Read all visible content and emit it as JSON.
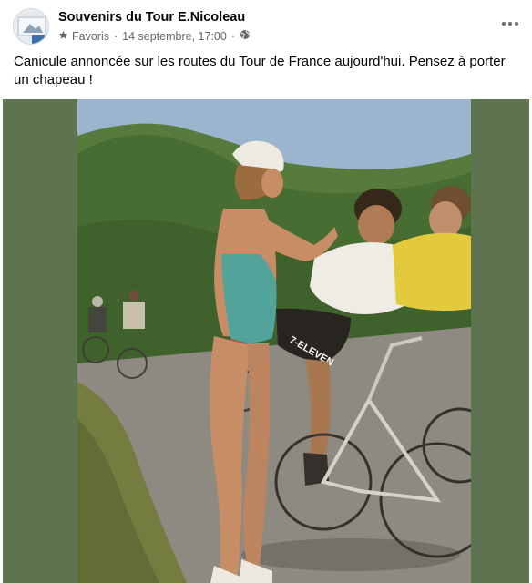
{
  "post": {
    "author": "Souvenirs du Tour E.Nicoleau",
    "audience": "Favoris",
    "date": "14 septembre, 17:00",
    "separator": "·",
    "text": "Canicule annoncée sur les routes du Tour de France aujourd'hui. Pensez à porter un chapeau !",
    "more_icon": "more-options-icon"
  },
  "photo": {
    "jersey_text": "7-ELEVEN",
    "description_colors": {
      "side_panel": "#5e7350",
      "sky": "#9bb9d9",
      "hill": "#3f6b2f",
      "road": "#8b8a85",
      "yellow_jersey": "#e8cf3a"
    }
  }
}
